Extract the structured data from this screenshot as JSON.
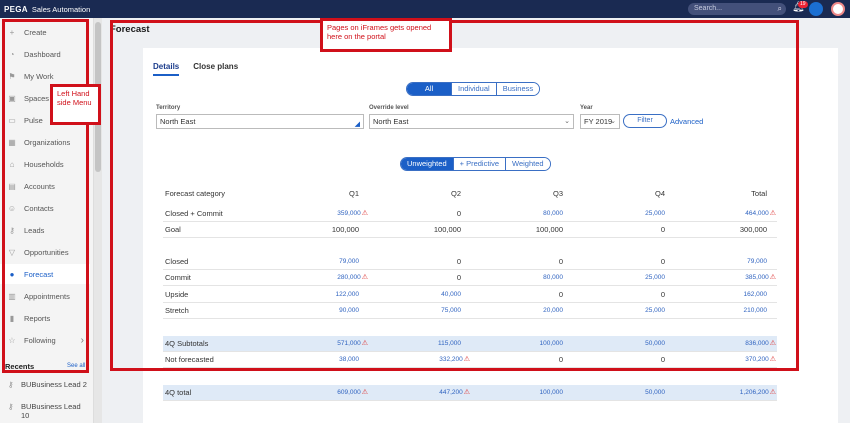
{
  "topbar": {
    "brand": "PEGA",
    "app": "Sales Automation",
    "search_placeholder": "Search...",
    "notif_count": "19"
  },
  "sidebar": {
    "items": [
      {
        "icon": "plus-icon",
        "glyph": "+",
        "label": "Create"
      },
      {
        "icon": "dashboard-icon",
        "glyph": "◔",
        "label": "Dashboard"
      },
      {
        "icon": "flag-icon",
        "glyph": "⚑",
        "label": "My Work"
      },
      {
        "icon": "spaces-icon",
        "glyph": "▣",
        "label": "Spaces"
      },
      {
        "icon": "pulse-icon",
        "glyph": "▭",
        "label": "Pulse"
      },
      {
        "icon": "organizations-icon",
        "glyph": "▦",
        "label": "Organizations"
      },
      {
        "icon": "households-icon",
        "glyph": "⌂",
        "label": "Households"
      },
      {
        "icon": "accounts-icon",
        "glyph": "▤",
        "label": "Accounts"
      },
      {
        "icon": "contacts-icon",
        "glyph": "☺",
        "label": "Contacts"
      },
      {
        "icon": "leads-icon",
        "glyph": "⚷",
        "label": "Leads"
      },
      {
        "icon": "opportunities-icon",
        "glyph": "▽",
        "label": "Opportunities"
      },
      {
        "icon": "forecast-icon",
        "glyph": "●",
        "label": "Forecast",
        "active": true
      },
      {
        "icon": "appointments-icon",
        "glyph": "▥",
        "label": "Appointments"
      },
      {
        "icon": "reports-icon",
        "glyph": "▮",
        "label": "Reports"
      },
      {
        "icon": "star-icon",
        "glyph": "☆",
        "label": "Following"
      }
    ],
    "recents_label": "Recents",
    "see_all": "See all",
    "recents": [
      "BUBusiness Lead 2",
      "BUBusiness Lead 10"
    ]
  },
  "page": {
    "title": "Forecast",
    "tabs": [
      "Details",
      "Close plans"
    ],
    "scope_options": [
      "All",
      "Individual",
      "Business"
    ],
    "territory_label": "Territory",
    "territory_value": "North East",
    "override_label": "Override level",
    "override_value": "North East",
    "year_label": "Year",
    "year_value": "FY 2019",
    "filter_label": "Filter",
    "advanced_label": "Advanced",
    "mode_options": [
      "Unweighted",
      "+ Predictive",
      "Weighted"
    ]
  },
  "table": {
    "columns": [
      "Forecast category",
      "Q1",
      "Q2",
      "Q3",
      "Q4",
      "Total"
    ],
    "rows": [
      {
        "label": "Closed + Commit",
        "q1": "359,000",
        "q1w": true,
        "q2": "0",
        "q3": "80,000",
        "q4": "25,000",
        "total": "464,000",
        "tw": true,
        "links": [
          true,
          false,
          true,
          true,
          true
        ]
      },
      {
        "label": "Goal",
        "q1": "100,000",
        "q2": "100,000",
        "q3": "100,000",
        "q4": "0",
        "total": "300,000",
        "links": [
          false,
          false,
          false,
          false,
          false
        ]
      },
      {
        "label": "Closed",
        "q1": "79,000",
        "q2": "0",
        "q3": "0",
        "q4": "0",
        "total": "79,000",
        "links": [
          true,
          false,
          false,
          false,
          true
        ]
      },
      {
        "label": "Commit",
        "q1": "280,000",
        "q1w": true,
        "q2": "0",
        "q3": "80,000",
        "q4": "25,000",
        "total": "385,000",
        "tw": true,
        "links": [
          true,
          false,
          true,
          true,
          true
        ]
      },
      {
        "label": "Upside",
        "q1": "122,000",
        "q2": "40,000",
        "q3": "0",
        "q4": "0",
        "total": "162,000",
        "links": [
          true,
          true,
          false,
          false,
          true
        ]
      },
      {
        "label": "Stretch",
        "q1": "90,000",
        "q2": "75,000",
        "q3": "20,000",
        "q4": "25,000",
        "total": "210,000",
        "links": [
          true,
          true,
          true,
          true,
          true
        ]
      },
      {
        "label": "4Q Subtotals",
        "q1": "571,000",
        "q1w": true,
        "q2": "115,000",
        "q3": "100,000",
        "q4": "50,000",
        "total": "836,000",
        "tw": true,
        "hl": true,
        "links": [
          true,
          true,
          true,
          true,
          true
        ]
      },
      {
        "label": "Not forecasted",
        "q1": "38,000",
        "q2": "332,200",
        "q2w": true,
        "q3": "0",
        "q4": "0",
        "total": "370,200",
        "tw": true,
        "links": [
          true,
          true,
          false,
          false,
          true
        ]
      },
      {
        "label": "4Q total",
        "q1": "609,000",
        "q1w": true,
        "q2": "447,200",
        "q2w": true,
        "q3": "100,000",
        "q4": "50,000",
        "total": "1,206,200",
        "tw": true,
        "hl": true,
        "links": [
          true,
          true,
          true,
          true,
          true
        ]
      }
    ]
  },
  "annotations": {
    "iframe_note": "Pages on iFrames gets opened here on the portal",
    "menu_note": "Left Hand side Menu"
  },
  "colors": {
    "topbar": "#1a2a52",
    "accent": "#1b5fc7",
    "annotation": "#d0101a"
  }
}
